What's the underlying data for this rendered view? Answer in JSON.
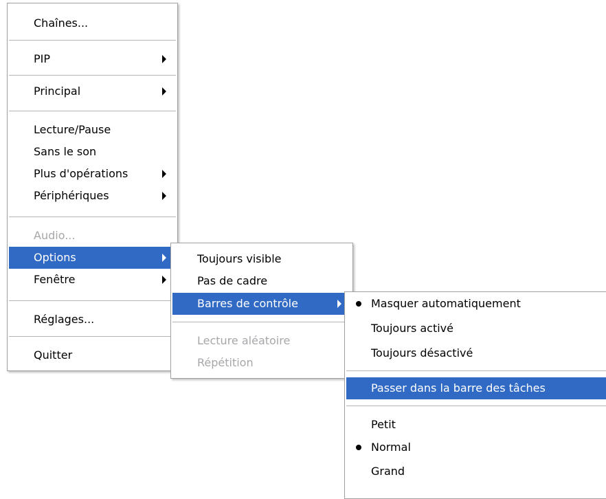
{
  "main_menu": {
    "channels": "Chaînes...",
    "pip": "PIP",
    "principal": "Principal",
    "play_pause": "Lecture/Pause",
    "mute": "Sans le son",
    "more_operations": "Plus d'opérations",
    "devices": "Périphériques",
    "audio": "Audio...",
    "options": "Options",
    "window": "Fenêtre",
    "settings": "Réglages...",
    "quit": "Quitter"
  },
  "options_menu": {
    "always_on_top": "Toujours visible",
    "no_frame": "Pas de cadre",
    "control_bars": "Barres de contrôle",
    "shuffle": "Lecture aléatoire",
    "repeat": "Répétition"
  },
  "control_bars_menu": {
    "auto_hide": "Masquer automatiquement",
    "always_on": "Toujours activé",
    "always_off": "Toujours désactivé",
    "to_taskbar": "Passer dans la barre des tâches",
    "small": "Petit",
    "normal": "Normal",
    "large": "Grand"
  },
  "colors": {
    "highlight": "#316ac5",
    "disabled_text": "#a7a6aa"
  }
}
